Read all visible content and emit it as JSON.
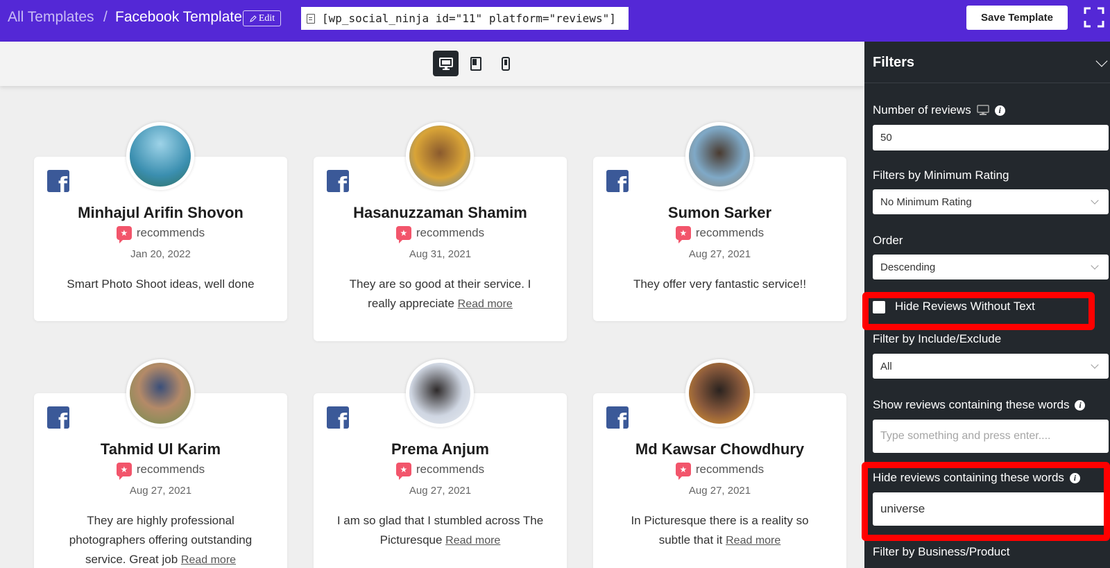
{
  "header": {
    "breadcrumb_all": "All Templates",
    "breadcrumb_sep": "/",
    "breadcrumb_current": "Facebook Template",
    "edit_label": "Edit",
    "shortcode": "[wp_social_ninja id=\"11\" platform=\"reviews\"]",
    "save_label": "Save Template"
  },
  "devices": [
    "desktop-icon",
    "tablet-icon",
    "mobile-icon"
  ],
  "reviews": [
    {
      "name": "Minhajul Arifin Shovon",
      "recommends": "recommends",
      "date": "Jan 20, 2022",
      "text": "Smart Photo Shoot ideas, well done",
      "more": ""
    },
    {
      "name": "Hasanuzzaman Shamim",
      "recommends": "recommends",
      "date": "Aug 31, 2021",
      "text": "They are so good at their service. I really appreciate",
      "more": "Read more"
    },
    {
      "name": "Sumon Sarker",
      "recommends": "recommends",
      "date": "Aug 27, 2021",
      "text": "They offer very fantastic service!!",
      "more": ""
    },
    {
      "name": "Tahmid Ul Karim",
      "recommends": "recommends",
      "date": "Aug 27, 2021",
      "text": "They are highly professional photographers offering outstanding service. Great job",
      "more": "Read more"
    },
    {
      "name": "Prema Anjum",
      "recommends": "recommends",
      "date": "Aug 27, 2021",
      "text": "I am so glad that I stumbled across The Picturesque",
      "more": "Read more"
    },
    {
      "name": "Md Kawsar Chowdhury",
      "recommends": "recommends",
      "date": "Aug 27, 2021",
      "text": "In Picturesque there is a reality so subtle that it",
      "more": "Read more"
    }
  ],
  "filters": {
    "title": "Filters",
    "num_reviews_label": "Number of reviews",
    "num_reviews_value": "50",
    "min_rating_label": "Filters by Minimum Rating",
    "min_rating_value": "No Minimum Rating",
    "order_label": "Order",
    "order_value": "Descending",
    "hide_no_text_label": "Hide Reviews Without Text",
    "hide_no_text_checked": false,
    "include_exclude_label": "Filter by Include/Exclude",
    "include_exclude_value": "All",
    "show_words_label": "Show reviews containing these words",
    "show_words_placeholder": "Type something and press enter....",
    "hide_words_label": "Hide reviews containing these words",
    "hide_words_value": "universe",
    "business_label": "Filter by Business/Product"
  },
  "colors": {
    "header_bg": "#5428d6",
    "sidebar_bg": "#23282d",
    "facebook_blue": "#3b5998",
    "recommend_badge": "#f2556b",
    "highlight": "#ff0000"
  }
}
